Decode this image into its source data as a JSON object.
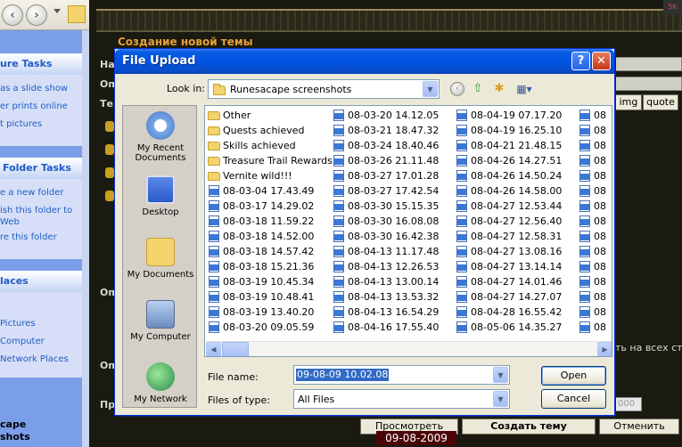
{
  "explorer": {
    "sections": [
      {
        "title": "ure Tasks",
        "links": [
          "as a slide show",
          "er prints online",
          "t pictures"
        ]
      },
      {
        "title": "Folder Tasks",
        "links": [
          "e a new folder",
          "ish this folder to",
          "Web",
          "re this folder"
        ]
      },
      {
        "title": "laces",
        "links": [
          "Pictures",
          "Computer",
          "Network Places"
        ]
      }
    ],
    "bottom_text": [
      "cape",
      "shots"
    ]
  },
  "forum": {
    "title": "Создание новой темы",
    "labels": [
      "На",
      "Оп",
      "Те",
      "Оп",
      "Оп",
      "Пр"
    ],
    "tag_buttons": [
      "img",
      "quote"
    ],
    "side_text": "ть на всех стр",
    "field_value": "000",
    "buttons": {
      "preview": "Просмотреть",
      "create": "Создать тему",
      "cancel": "Отменить"
    },
    "date_stamp": "09-08-2009",
    "corner_icon": "5K"
  },
  "dialog": {
    "title": "File Upload",
    "help_label": "?",
    "close_label": "✕",
    "look_in_label": "Look in:",
    "look_in_value": "Runesacape screenshots",
    "places": [
      "My Recent Documents",
      "Desktop",
      "My Documents",
      "My Computer",
      "My Network"
    ],
    "columns": [
      {
        "items": [
          {
            "name": "Other",
            "type": "folder"
          },
          {
            "name": "Quests achieved",
            "type": "folder"
          },
          {
            "name": "Skills achieved",
            "type": "folder"
          },
          {
            "name": "Treasure Trail Rewards",
            "type": "folder"
          },
          {
            "name": "Vernite wild!!!",
            "type": "folder"
          },
          {
            "name": "08-03-04 17.43.49",
            "type": "image"
          },
          {
            "name": "08-03-17 14.29.02",
            "type": "image"
          },
          {
            "name": "08-03-18 11.59.22",
            "type": "image"
          },
          {
            "name": "08-03-18 14.52.00",
            "type": "image"
          },
          {
            "name": "08-03-18 14.57.42",
            "type": "image"
          },
          {
            "name": "08-03-18 15.21.36",
            "type": "image"
          },
          {
            "name": "08-03-19 10.45.34",
            "type": "image"
          },
          {
            "name": "08-03-19 10.48.41",
            "type": "image"
          },
          {
            "name": "08-03-19 13.40.20",
            "type": "image"
          },
          {
            "name": "08-03-20 09.05.59",
            "type": "image"
          }
        ]
      },
      {
        "items": [
          {
            "name": "08-03-20 14.12.05",
            "type": "image"
          },
          {
            "name": "08-03-21 18.47.32",
            "type": "image"
          },
          {
            "name": "08-03-24 18.40.46",
            "type": "image"
          },
          {
            "name": "08-03-26 21.11.48",
            "type": "image"
          },
          {
            "name": "08-03-27 17.01.28",
            "type": "image"
          },
          {
            "name": "08-03-27 17.42.54",
            "type": "image"
          },
          {
            "name": "08-03-30 15.15.35",
            "type": "image"
          },
          {
            "name": "08-03-30 16.08.08",
            "type": "image"
          },
          {
            "name": "08-03-30 16.42.38",
            "type": "image"
          },
          {
            "name": "08-04-13 11.17.48",
            "type": "image"
          },
          {
            "name": "08-04-13 12.26.53",
            "type": "image"
          },
          {
            "name": "08-04-13 13.00.14",
            "type": "image"
          },
          {
            "name": "08-04-13 13.53.32",
            "type": "image"
          },
          {
            "name": "08-04-13 16.54.29",
            "type": "image"
          },
          {
            "name": "08-04-16 17.55.40",
            "type": "image"
          }
        ]
      },
      {
        "items": [
          {
            "name": "08-04-19 07.17.20",
            "type": "image"
          },
          {
            "name": "08-04-19 16.25.10",
            "type": "image"
          },
          {
            "name": "08-04-21 21.48.15",
            "type": "image"
          },
          {
            "name": "08-04-26 14.27.51",
            "type": "image"
          },
          {
            "name": "08-04-26 14.50.24",
            "type": "image"
          },
          {
            "name": "08-04-26 14.58.00",
            "type": "image"
          },
          {
            "name": "08-04-27 12.53.44",
            "type": "image"
          },
          {
            "name": "08-04-27 12.56.40",
            "type": "image"
          },
          {
            "name": "08-04-27 12.58.31",
            "type": "image"
          },
          {
            "name": "08-04-27 13.08.16",
            "type": "image"
          },
          {
            "name": "08-04-27 13.14.14",
            "type": "image"
          },
          {
            "name": "08-04-27 14.01.46",
            "type": "image"
          },
          {
            "name": "08-04-27 14.27.07",
            "type": "image"
          },
          {
            "name": "08-04-28 16.55.42",
            "type": "image"
          },
          {
            "name": "08-05-06 14.35.27",
            "type": "image"
          }
        ]
      },
      {
        "items": [
          {
            "name": "08",
            "type": "image"
          },
          {
            "name": "08",
            "type": "image"
          },
          {
            "name": "08",
            "type": "image"
          },
          {
            "name": "08",
            "type": "image"
          },
          {
            "name": "08",
            "type": "image"
          },
          {
            "name": "08",
            "type": "image"
          },
          {
            "name": "08",
            "type": "image"
          },
          {
            "name": "08",
            "type": "image"
          },
          {
            "name": "08",
            "type": "image"
          },
          {
            "name": "08",
            "type": "image"
          },
          {
            "name": "08",
            "type": "image"
          },
          {
            "name": "08",
            "type": "image"
          },
          {
            "name": "08",
            "type": "image"
          },
          {
            "name": "08",
            "type": "image"
          },
          {
            "name": "08",
            "type": "image"
          }
        ]
      }
    ],
    "file_name_label": "File name:",
    "file_name_value": "09-08-09 10.02.08",
    "file_type_label": "Files of type:",
    "file_type_value": "All Files",
    "open_label": "Open",
    "cancel_label": "Cancel"
  },
  "colors": {
    "titlebar": "#0054e3",
    "forum_title": "#e8a038",
    "selection": "#316ac5"
  }
}
